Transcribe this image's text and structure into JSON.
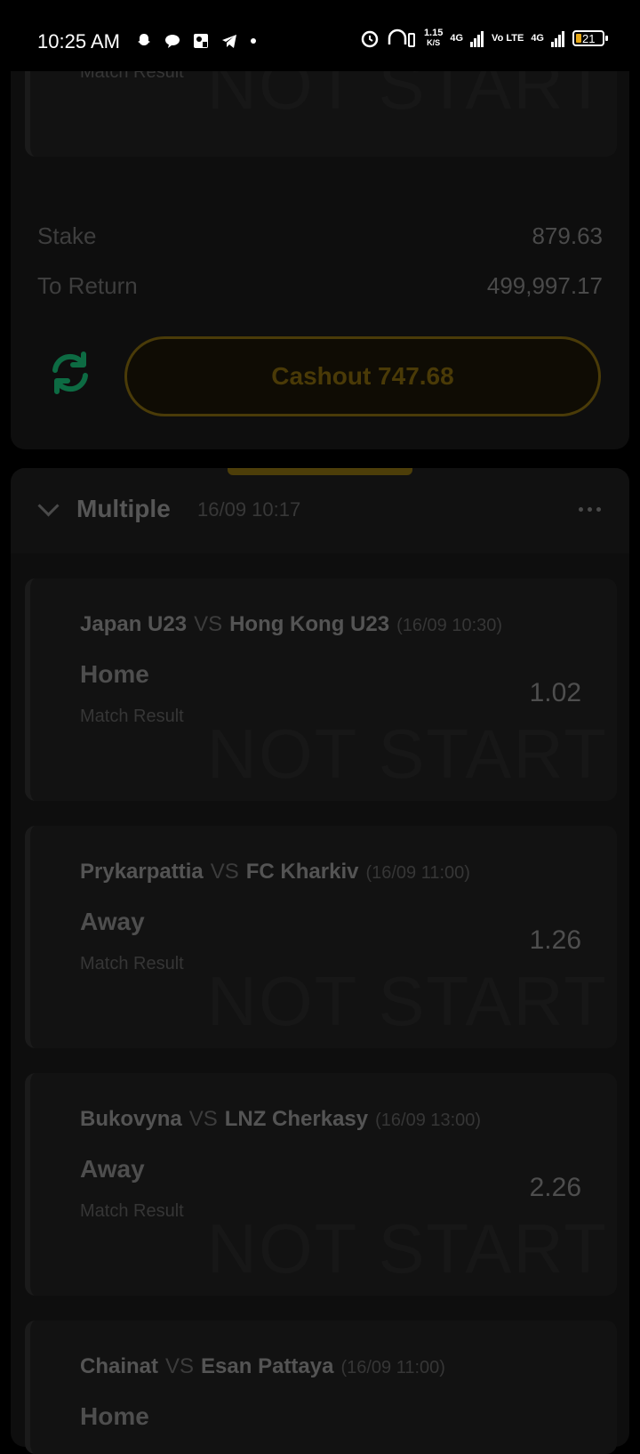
{
  "status_bar": {
    "time": "10:25 AM",
    "net_speed": "1.15",
    "net_speed_unit": "K/S",
    "signal1": "4G",
    "volte": "Vo LTE",
    "signal2": "4G",
    "battery": "21"
  },
  "top_bet": {
    "market": "Match Result",
    "watermark": "NOT START",
    "stake_label": "Stake",
    "stake_value": "879.63",
    "return_label": "To Return",
    "return_value": "499,997.17",
    "cashout_label": "Cashout 747.68"
  },
  "multiple": {
    "title": "Multiple",
    "date": "16/09 10:17",
    "legs": [
      {
        "home": "Japan U23",
        "vs": "VS",
        "away": "Hong Kong U23",
        "date": "(16/09 10:30)",
        "pick": "Home",
        "market": "Match Result",
        "odds": "1.02",
        "watermark": "NOT START"
      },
      {
        "home": "Prykarpattia",
        "vs": "VS",
        "away": "FC Kharkiv",
        "date": "(16/09 11:00)",
        "pick": "Away",
        "market": "Match Result",
        "odds": "1.26",
        "watermark": "NOT START"
      },
      {
        "home": "Bukovyna",
        "vs": "VS",
        "away": "LNZ Cherkasy",
        "date": "(16/09 13:00)",
        "pick": "Away",
        "market": "Match Result",
        "odds": "2.26",
        "watermark": "NOT START"
      },
      {
        "home": "Chainat",
        "vs": "VS",
        "away": "Esan Pattaya",
        "date": "(16/09 11:00)",
        "pick": "Home",
        "market": "",
        "odds": "",
        "watermark": ""
      }
    ]
  },
  "colors": {
    "accent": "#e6a817",
    "refresh_green": "#0d6b43"
  }
}
